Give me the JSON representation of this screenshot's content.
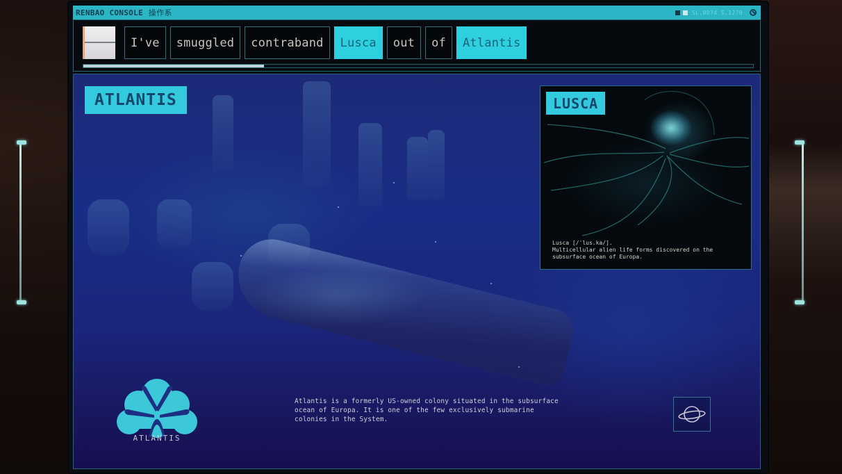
{
  "window": {
    "title": "RENBAO CONSOLE",
    "title_cjk": "操作系",
    "status_readout": "SL.0074 S.127θ",
    "status_icon": "no-entry-icon"
  },
  "header": {
    "menu_icon": "menu-icon",
    "sentence": [
      {
        "text": "I've",
        "active": false
      },
      {
        "text": "smuggled",
        "active": false
      },
      {
        "text": "contraband",
        "active": false
      },
      {
        "text": "Lusca",
        "active": true
      },
      {
        "text": "out",
        "active": false
      },
      {
        "text": "of",
        "active": true
      }
    ],
    "words": {
      "w0": "I've",
      "w1": "smuggled",
      "w2": "contraband",
      "w3": "Lusca",
      "w4": "out",
      "w5": "of",
      "w6": "Atlantis"
    },
    "active_words": [
      "Lusca",
      "Atlantis"
    ],
    "progress_percent": 27
  },
  "main": {
    "location_label": "ATLANTIS",
    "logo_text": "ATLANTIS",
    "description": "Atlantis is a formerly US-owned colony situated in the subsurface ocean of Europa. It is one of the few exclusively submarine colonies in the System.",
    "planet_icon": "planet-icon"
  },
  "card": {
    "label": "LUSCA",
    "caption_line1": "Lusca [/ˈlus.ka/].",
    "caption_line2": "Multicellular alien life forms discovered on the subsurface ocean of Europa."
  },
  "colors": {
    "accent": "#2ed0e0",
    "title_bar": "#2bb6c6",
    "label_text": "#15476a",
    "screen_bg": "#1a2d86"
  }
}
